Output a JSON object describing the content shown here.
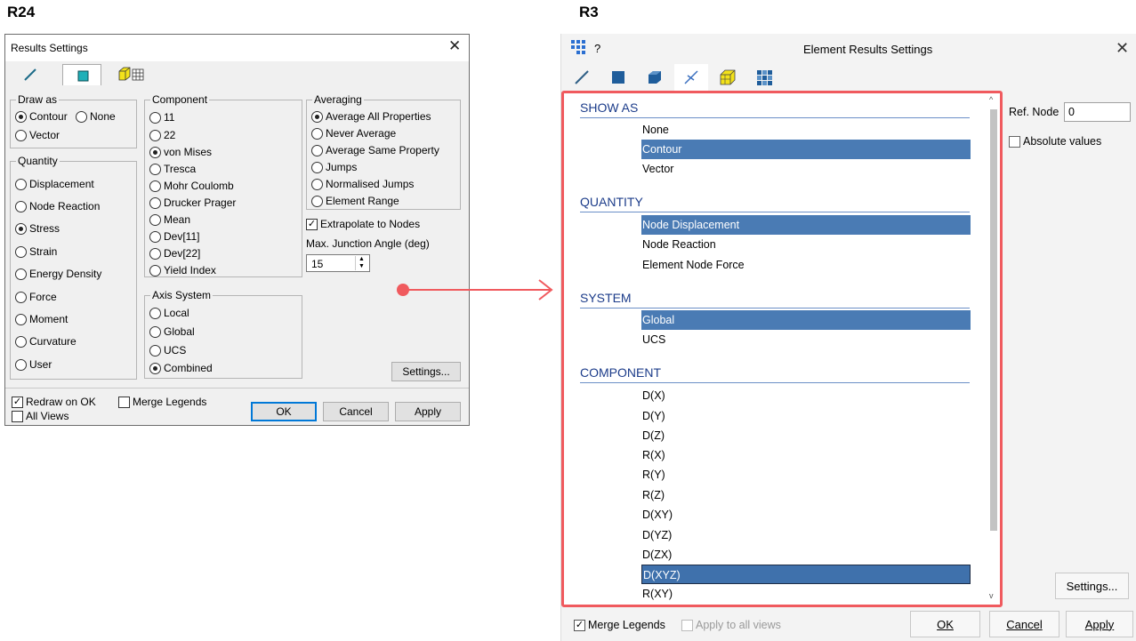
{
  "labels": {
    "left": "R24",
    "right": "R3"
  },
  "old_dialog": {
    "title": "Results Settings",
    "close": "✕",
    "draw_as": {
      "label": "Draw as",
      "options": [
        "Contour",
        "None",
        "Vector"
      ],
      "selected": "Contour"
    },
    "quantity": {
      "label": "Quantity",
      "options": [
        "Displacement",
        "Node Reaction",
        "Stress",
        "Strain",
        "Energy Density",
        "Force",
        "Moment",
        "Curvature",
        "User"
      ],
      "selected": "Stress"
    },
    "component": {
      "label": "Component",
      "options": [
        "11",
        "22",
        "von Mises",
        "Tresca",
        "Mohr Coulomb",
        "Drucker Prager",
        "Mean",
        "Dev[11]",
        "Dev[22]",
        "Yield Index"
      ],
      "selected": "von Mises"
    },
    "axis_system": {
      "label": "Axis System",
      "options": [
        "Local",
        "Global",
        "UCS",
        "Combined"
      ],
      "selected": "Combined"
    },
    "averaging": {
      "label": "Averaging",
      "options": [
        "Average All Properties",
        "Never Average",
        "Average Same Property",
        "Jumps",
        "Normalised Jumps",
        "Element Range"
      ],
      "selected": "Average All Properties"
    },
    "extrapolate": {
      "label": "Extrapolate to Nodes",
      "checked": true
    },
    "junction_label": "Max. Junction Angle (deg)",
    "junction_value": "15",
    "settings_button": "Settings...",
    "redraw": {
      "label": "Redraw on OK",
      "checked": true
    },
    "all_views": {
      "label": "All Views",
      "checked": false
    },
    "merge_legends": {
      "label": "Merge Legends",
      "checked": false
    },
    "buttons": {
      "ok": "OK",
      "cancel": "Cancel",
      "apply": "Apply"
    }
  },
  "new_dialog": {
    "title": "Element Results Settings",
    "help": "?",
    "close": "✕",
    "sections": [
      {
        "title": "SHOW AS",
        "items": [
          "None",
          "Contour",
          "Vector"
        ],
        "selected": "Contour"
      },
      {
        "title": "QUANTITY",
        "items": [
          "Node Displacement",
          "Node Reaction",
          "Element Node Force"
        ],
        "selected": "Node Displacement"
      },
      {
        "title": "SYSTEM",
        "items": [
          "Global",
          "UCS"
        ],
        "selected": "Global"
      },
      {
        "title": "COMPONENT",
        "items": [
          "D(X)",
          "D(Y)",
          "D(Z)",
          "R(X)",
          "R(Y)",
          "R(Z)",
          "D(XY)",
          "D(YZ)",
          "D(ZX)",
          "D(XYZ)",
          "R(XY)"
        ],
        "selected": "D(XYZ)"
      }
    ],
    "ref_node_label": "Ref. Node",
    "ref_node_value": "0",
    "absolute_values": {
      "label": "Absolute values",
      "checked": false
    },
    "settings_button": "Settings...",
    "merge_legends": {
      "label": "Merge Legends",
      "checked": true
    },
    "apply_all_views": {
      "label": "Apply to all views",
      "checked": false
    },
    "buttons": {
      "ok": "OK",
      "cancel": "Cancel",
      "apply": "Apply"
    }
  },
  "colors": {
    "highlight_border": "#f05a5e",
    "arrow": "#f05a5e",
    "selection": "#4a7bb4",
    "section_text": "#1c3c8a"
  }
}
